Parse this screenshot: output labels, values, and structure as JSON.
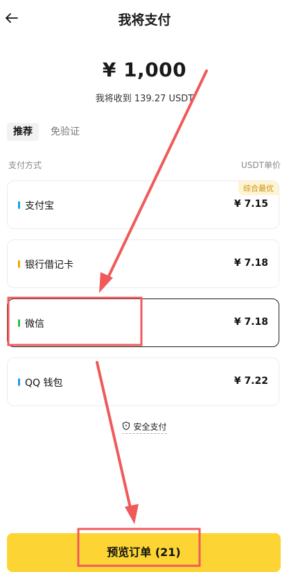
{
  "header": {
    "title": "我将支付"
  },
  "amount": "¥ 1,000",
  "receive_text": "我将收到 139.27 USDT",
  "tabs": [
    {
      "label": "推荐",
      "active": true
    },
    {
      "label": "免验证",
      "active": false
    }
  ],
  "columns": {
    "left": "支付方式",
    "right": "USDT单价"
  },
  "methods": [
    {
      "name": "支付宝",
      "price": "¥ 7.15",
      "color": "#1e9fe8",
      "badge": "综合最优",
      "selected": false
    },
    {
      "name": "银行借记卡",
      "price": "¥ 7.18",
      "color": "#f2a900",
      "selected": false
    },
    {
      "name": "微信",
      "price": "¥ 7.18",
      "color": "#2dbf3f",
      "selected": true
    },
    {
      "name": "QQ 钱包",
      "price": "¥ 7.22",
      "color": "#1e9fe8",
      "selected": false
    }
  ],
  "secure_label": "安全支付",
  "cta_label": "预览订单 (21)",
  "annotation_color": "#f05a5a"
}
